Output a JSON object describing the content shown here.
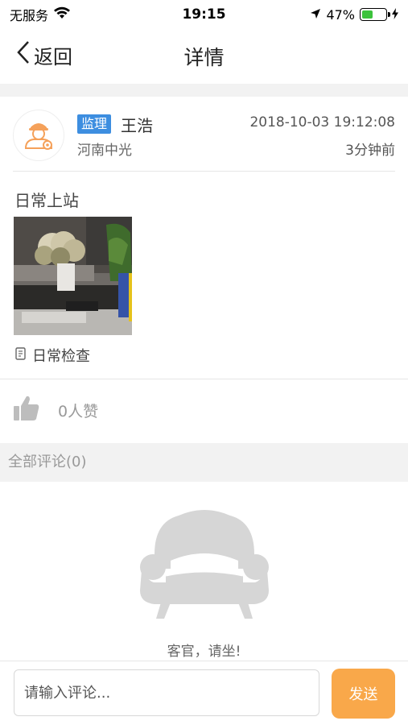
{
  "status_bar": {
    "carrier": "无服务",
    "time": "19:15",
    "battery_percent": "47%",
    "battery_level": 0.47
  },
  "nav": {
    "back_label": "返回",
    "title": "详情"
  },
  "post": {
    "role": "监理",
    "author": "王浩",
    "company": "河南中光",
    "datetime": "2018-10-03 19:12:08",
    "relative_time": "3分钟前",
    "title": "日常上站",
    "category": "日常检查"
  },
  "likes": {
    "label": "0人赞"
  },
  "comments": {
    "header": "全部评论(0)",
    "empty_text": "客官，请坐!"
  },
  "input": {
    "placeholder": "请输入评论...",
    "send_label": "发送"
  },
  "colors": {
    "badge": "#3d8ee0",
    "send": "#f9a84a",
    "battery": "#3cc23c"
  }
}
